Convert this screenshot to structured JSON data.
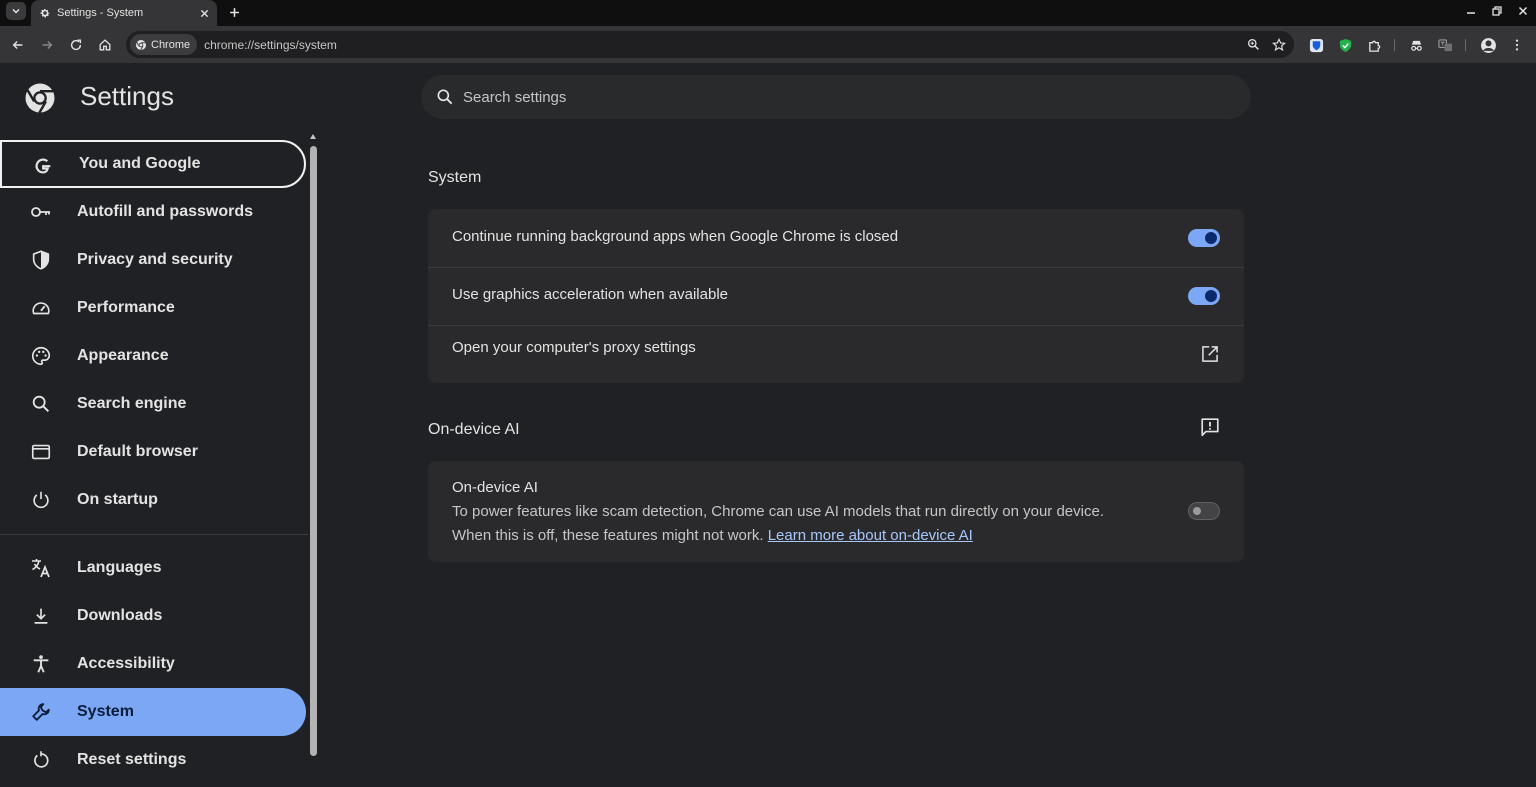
{
  "browser": {
    "tab_title": "Settings - System",
    "omnibox": {
      "chip_label": "Chrome",
      "url": "chrome://settings/system"
    }
  },
  "settings": {
    "title": "Settings",
    "search_placeholder": "Search settings"
  },
  "sidebar": {
    "items": [
      {
        "label": "You and Google",
        "icon": "google-g-icon"
      },
      {
        "label": "Autofill and passwords",
        "icon": "key-icon"
      },
      {
        "label": "Privacy and security",
        "icon": "shield-icon"
      },
      {
        "label": "Performance",
        "icon": "gauge-icon"
      },
      {
        "label": "Appearance",
        "icon": "palette-icon"
      },
      {
        "label": "Search engine",
        "icon": "search-icon"
      },
      {
        "label": "Default browser",
        "icon": "browser-window-icon"
      },
      {
        "label": "On startup",
        "icon": "power-icon"
      },
      {
        "label": "Languages",
        "icon": "translate-icon"
      },
      {
        "label": "Downloads",
        "icon": "download-icon"
      },
      {
        "label": "Accessibility",
        "icon": "accessibility-icon"
      },
      {
        "label": "System",
        "icon": "wrench-icon"
      },
      {
        "label": "Reset settings",
        "icon": "reset-icon"
      }
    ]
  },
  "system_section": {
    "title": "System",
    "rows": [
      {
        "label": "Continue running background apps when Google Chrome is closed",
        "toggle": true
      },
      {
        "label": "Use graphics acceleration when available",
        "toggle": true
      },
      {
        "label": "Open your computer's proxy settings"
      }
    ]
  },
  "ai_section": {
    "title": "On-device AI",
    "row": {
      "title": "On-device AI",
      "description_line1": "To power features like scam detection, Chrome can use AI models that run directly on your device.",
      "description_line2": "When this is off, these features might not work.",
      "link_text": "Learn more about on-device AI",
      "toggle": false
    }
  },
  "colors": {
    "accent": "#7ca7f5",
    "background": "#202124",
    "card": "#2a2a2c",
    "link": "#a8c7fa"
  }
}
